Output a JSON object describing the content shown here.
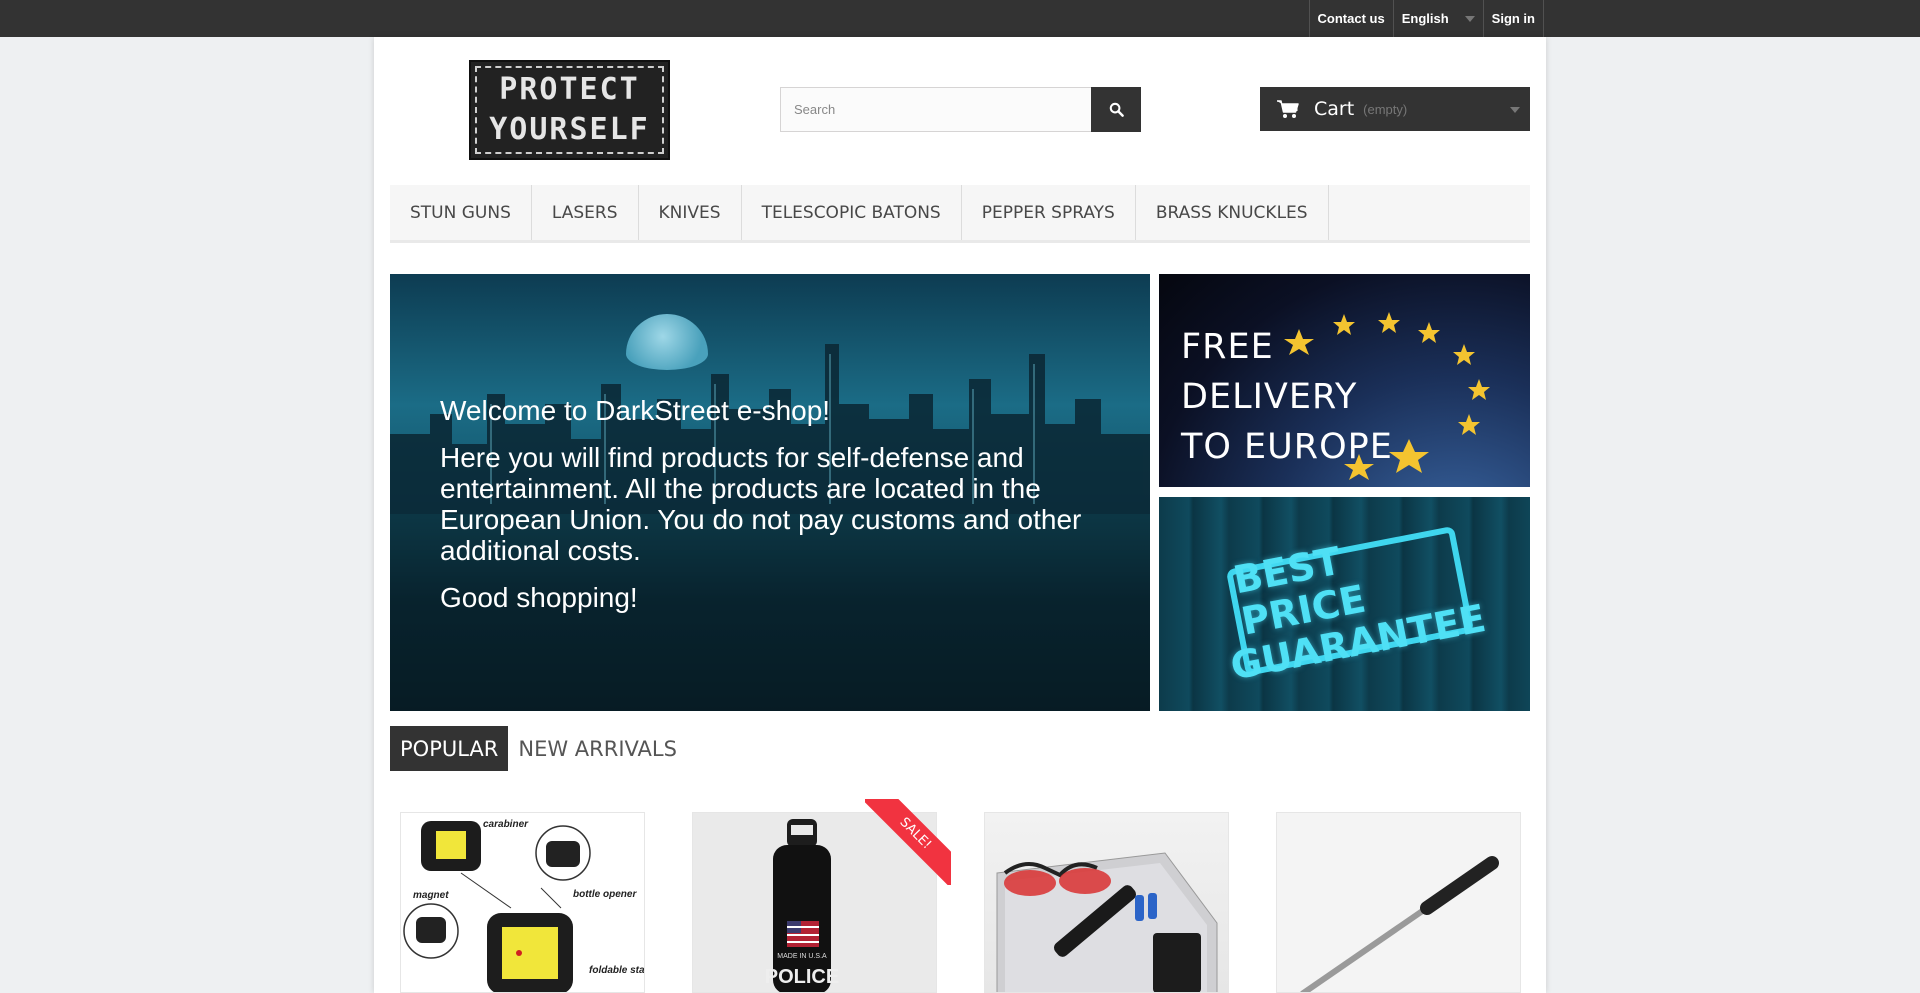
{
  "topbar": {
    "contact": "Contact us",
    "language": "English",
    "signin": "Sign in"
  },
  "logo": {
    "line1": "PROTECT",
    "line2": "YOURSELF"
  },
  "search": {
    "placeholder": "Search",
    "icon": "search-icon"
  },
  "cart": {
    "label": "Cart",
    "status": "(empty)",
    "icon": "cart-icon"
  },
  "menu": {
    "items": [
      {
        "label": "STUN GUNS"
      },
      {
        "label": "LASERS"
      },
      {
        "label": "KNIVES"
      },
      {
        "label": "TELESCOPIC BATONS"
      },
      {
        "label": "PEPPER SPRAYS"
      },
      {
        "label": "BRASS KNUCKLES"
      }
    ]
  },
  "hero": {
    "title": "Welcome to DarkStreet e-shop!",
    "body": "Here you will find products for self-defense and entertainment. All the products are located in the European Union. You do not pay customs and other additional costs.",
    "closing": "Good shopping!"
  },
  "banners": {
    "delivery_line1": "FREE",
    "delivery_line2": "DELIVERY",
    "delivery_line3": "TO EUROPE",
    "guarantee_line1": "BEST PRICE",
    "guarantee_line2": "GUARANTEE"
  },
  "tabs": {
    "popular": "POPULAR",
    "new_arrivals": "NEW ARRIVALS"
  },
  "products": {
    "p1_labels": [
      "carabiner",
      "bottle opener",
      "magnet",
      "foldable stand"
    ],
    "p2_labels": [
      "MADE IN U.S.A",
      "POLICE"
    ],
    "sale_badge": "SALE!"
  },
  "colors": {
    "dark": "#333333",
    "sale": "#f13340",
    "accent_cyan": "#4fe0f5"
  }
}
